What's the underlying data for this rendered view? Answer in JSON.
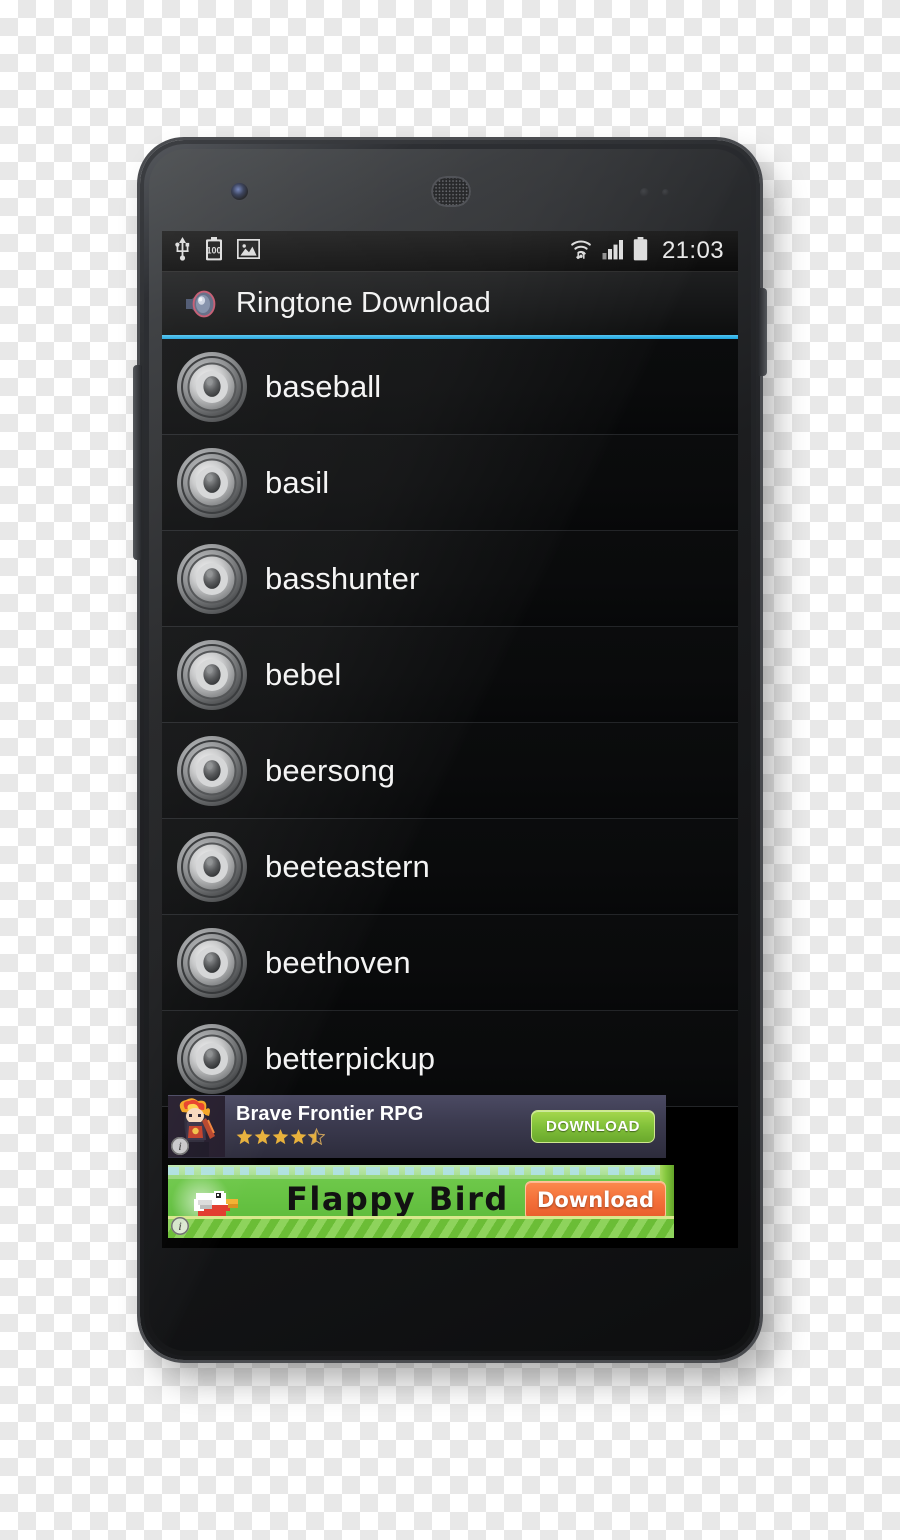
{
  "device": {
    "name": "android-smartphone",
    "hardware": {
      "front_camera": "front-camera",
      "earpiece": "earpiece-speaker",
      "sensors": "proximity-sensor",
      "volume_rocker": "volume-rocker-button",
      "power_button": "power-button"
    }
  },
  "status_bar": {
    "left_icons": [
      "usb-icon",
      "battery-100-icon",
      "screenshot-image-icon"
    ],
    "battery_label": "100",
    "right_icons": [
      "wifi-icon",
      "cellular-signal-icon",
      "battery-icon"
    ],
    "clock": "21:03"
  },
  "action_bar": {
    "icon": "speaker-app-icon",
    "title": "Ringtone Download",
    "accent_color": "#33b5e5"
  },
  "list": {
    "items": [
      {
        "label": "baseball",
        "icon": "subwoofer-speaker-icon"
      },
      {
        "label": "basil",
        "icon": "subwoofer-speaker-icon"
      },
      {
        "label": "basshunter",
        "icon": "subwoofer-speaker-icon"
      },
      {
        "label": "bebel",
        "icon": "subwoofer-speaker-icon"
      },
      {
        "label": "beersong",
        "icon": "subwoofer-speaker-icon"
      },
      {
        "label": "beeteastern",
        "icon": "subwoofer-speaker-icon"
      },
      {
        "label": "beethoven",
        "icon": "subwoofer-speaker-icon"
      },
      {
        "label": "betterpickup",
        "icon": "subwoofer-speaker-icon"
      }
    ]
  },
  "ads": {
    "brave_frontier": {
      "title": "Brave Frontier RPG",
      "rating": 4.5,
      "stars": [
        "full",
        "full",
        "full",
        "full",
        "half"
      ],
      "button_label": "DOWNLOAD",
      "button_color": "#82c13a",
      "adchoices_label": "i"
    },
    "flappy_bird": {
      "title": "Flappy Bird",
      "button_label": "Download",
      "button_color": "#f4703a",
      "background_color": "#6ec84a",
      "adchoices_label": "i"
    }
  }
}
